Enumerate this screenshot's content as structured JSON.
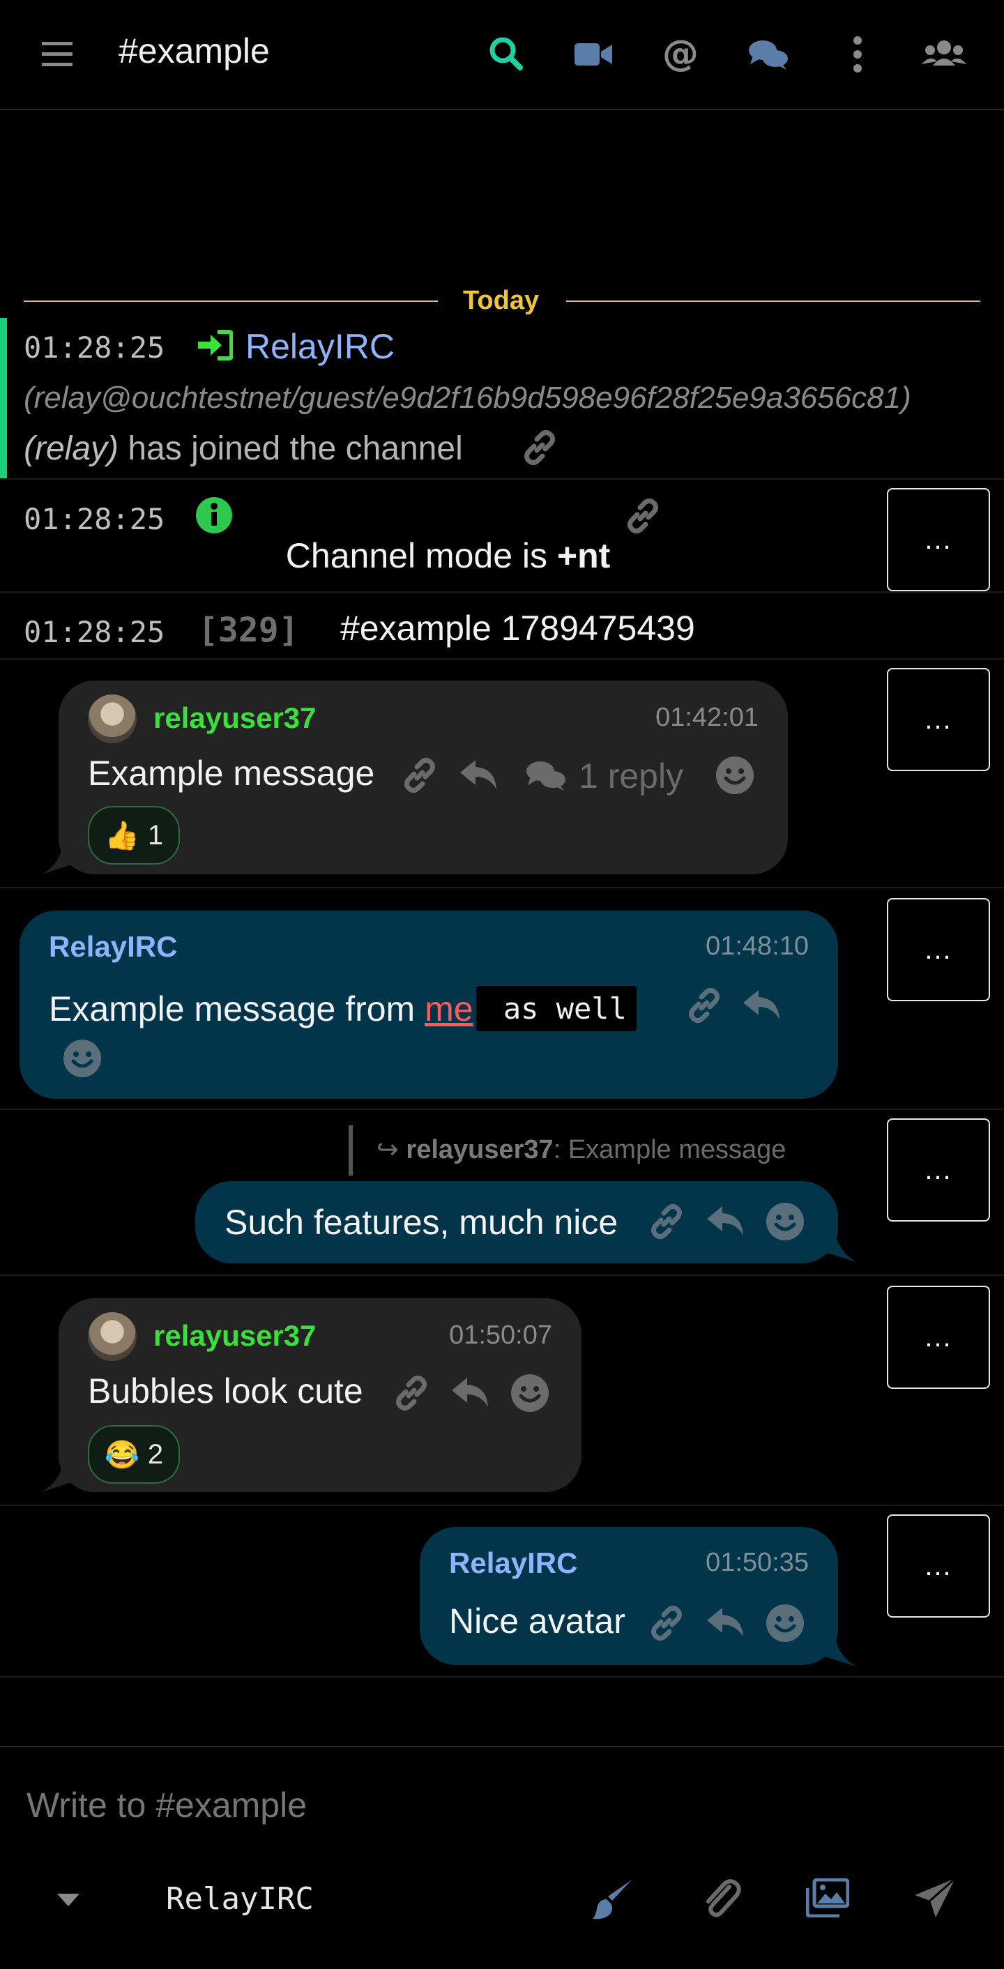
{
  "header": {
    "channel": "#example",
    "icons": [
      "menu-icon",
      "search-icon",
      "video-icon",
      "mention-icon",
      "chat-icon",
      "more-vertical-icon",
      "users-icon"
    ],
    "accent": "#1dd1a1"
  },
  "day_separator": "Today",
  "events": {
    "join": {
      "time": "01:28:25",
      "nick": "RelayIRC",
      "host": "(relay@ouchtestnet/guest/e9d2f16b9d598e96f28f25e9a3656c81)",
      "ident": "(relay)",
      "text": "has joined the channel"
    },
    "mode": {
      "time": "01:28:25",
      "text_prefix": "Channel mode is ",
      "mode": "+nt"
    },
    "numeric": {
      "time": "01:28:25",
      "code": "[329]",
      "text": "#example 1789475439"
    }
  },
  "messages": [
    {
      "nick": "relayuser37",
      "time": "01:42:01",
      "text": "Example message",
      "reply_count": "1 reply",
      "reaction_emoji": "👍",
      "reaction_count": "1"
    },
    {
      "nick": "RelayIRC",
      "time": "01:48:10",
      "text_prefix": "Example message from ",
      "highlight": "me",
      "code": " as well"
    },
    {
      "quote_nick": "relayuser37",
      "quote_text": ": Example message",
      "text": "Such features, much nice"
    },
    {
      "nick": "relayuser37",
      "time": "01:50:07",
      "text": "Bubbles look cute",
      "reaction_emoji": "😂",
      "reaction_count": "2"
    },
    {
      "nick": "RelayIRC",
      "time": "01:50:35",
      "text": "Nice avatar"
    }
  ],
  "more_label": "...",
  "composer": {
    "placeholder": "Write to #example",
    "nick": "RelayIRC"
  }
}
